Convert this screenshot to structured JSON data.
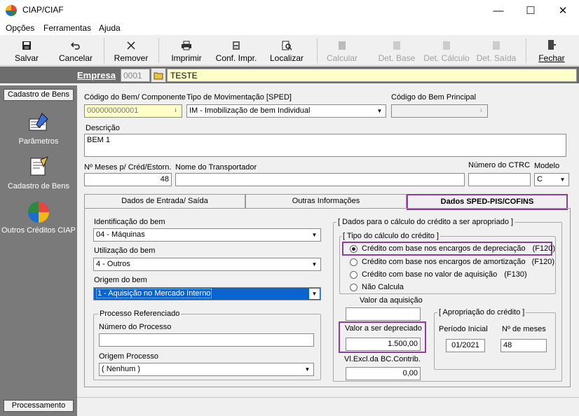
{
  "window": {
    "title": "CIAP/CIAF"
  },
  "menu": [
    "Opções",
    "Ferramentas",
    "Ajuda"
  ],
  "toolbar": {
    "salvar": "Salvar",
    "cancelar": "Cancelar",
    "remover": "Remover",
    "imprimir": "Imprimir",
    "conf_impr": "Conf. Impr.",
    "localizar": "Localizar",
    "calcular": "Calcular",
    "det_base": "Det. Base",
    "det_calculo": "Det. Cálculo",
    "det_saida": "Det. Saída",
    "fechar": "Fechar"
  },
  "empresa": {
    "label": "Empresa",
    "code": "0001",
    "name": "TESTE"
  },
  "sidebar": {
    "tab": "Cadastro de Bens",
    "items": [
      "Parâmetros",
      "Cadastro de Bens",
      "Outros Créditos CIAP"
    ],
    "footer": "Processamento"
  },
  "form": {
    "codigo_label": "Código do Bem/ Componente",
    "codigo_value": "000000000001",
    "tipo_mov_label": "Tipo de Movimentação [SPED]",
    "tipo_mov_value": "IM - Imobilização de bem Individual",
    "codigo_principal_label": "Código do Bem Principal",
    "codigo_principal_value": "",
    "descricao_label": "Descrição",
    "descricao_value": "BEM 1",
    "meses_label": "Nº Meses p/ Créd/Estorn.",
    "meses_value": "48",
    "transportador_label": "Nome do Transportador",
    "transportador_value": "",
    "ctrc_label": "Número do CTRC",
    "ctrc_value": "",
    "modelo_label": "Modelo",
    "modelo_value": "C"
  },
  "tabs": [
    "Dados de Entrada/ Saída",
    "Outras Informações",
    "Dados SPED-PIS/COFINS"
  ],
  "sped": {
    "ident_label": "Identificação do bem",
    "ident_value": "04 - Máquinas",
    "util_label": "Utilização do bem",
    "util_value": "4 - Outros",
    "origem_label": "Origem do bem",
    "origem_value": "1 - Aquisição no Mercado Interno",
    "proc_group": "Processo Referenciado",
    "num_proc_label": "Número do Processo",
    "num_proc_value": "",
    "origem_proc_label": "Origem Processo",
    "origem_proc_value": "( Nenhum )",
    "calc_group": "[ Dados para o cálculo do crédito a ser apropriado ]",
    "tipo_calc_group": "[ Tipo do cálculo do crédito ]",
    "radios": [
      {
        "label": "Crédito com base nos encargos de depreciação",
        "code": "(F120)",
        "selected": true
      },
      {
        "label": "Crédito com base nos encargos de amortização",
        "code": "(F120)",
        "selected": false
      },
      {
        "label": "Crédito com base no valor de aquisição",
        "code": "(F130)",
        "selected": false
      },
      {
        "label": "Não Calcula",
        "code": "",
        "selected": false
      }
    ],
    "valor_aquisicao_label": "Valor da aquisição",
    "valor_aquisicao_value": "",
    "valor_depreciado_label": "Valor a ser depreciado",
    "valor_depreciado_value": "1.500,00",
    "vl_excl_label": "Vl.Excl.da BC.Contrib.",
    "vl_excl_value": "0,00",
    "apropriacao_group": "[ Apropriação do crédito ]",
    "periodo_label": "Período Inicial",
    "periodo_value": "01/2021",
    "nmeses_label": "Nº de meses",
    "nmeses_value": "48"
  }
}
